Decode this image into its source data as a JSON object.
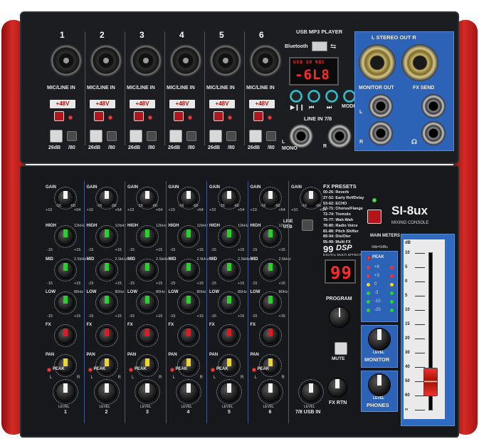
{
  "channels": [
    {
      "num": "1",
      "input": "MIC/LINE IN",
      "level": "LEVEL",
      "level_num": "1"
    },
    {
      "num": "2",
      "input": "MIC/LINE IN",
      "level": "LEVEL",
      "level_num": "2"
    },
    {
      "num": "3",
      "input": "MIC/LINE IN",
      "level": "LEVEL",
      "level_num": "3"
    },
    {
      "num": "4",
      "input": "MIC/LINE IN",
      "level": "LEVEL",
      "level_num": "4"
    },
    {
      "num": "5",
      "input": "MIC/LINE IN",
      "level": "LEVEL",
      "level_num": "5"
    },
    {
      "num": "6",
      "input": "MIC/LINE IN",
      "level": "LEVEL",
      "level_num": "6"
    }
  ],
  "phantom_label": "+48V",
  "pad_label": "26dB",
  "hpf_label": "/80",
  "strip": {
    "gain": "GAIN",
    "gain_min": "+10",
    "gain_mid1": "-16",
    "gain_mid2": "-60",
    "gain_max": "+54",
    "high": "HIGH",
    "high_freq": "12kHz",
    "mid": "MID",
    "mid_freq": "2.5kHz",
    "low": "LOW",
    "low_freq": "80Hz",
    "eq_min": "-15",
    "eq_max": "+15",
    "fx": "FX",
    "pan": "PAN",
    "pan_l": "L",
    "pan_r": "R",
    "peak": "PEAK"
  },
  "usb_player": {
    "title": "USB MP3 PLAYER",
    "bluetooth": "Bluetooth",
    "display": "-6L8",
    "ind": [
      "USB",
      "SD",
      "REC"
    ],
    "mode": "MODE"
  },
  "line_in_78": {
    "title": "LINE IN 7/8",
    "l": "L",
    "mono": "MONO",
    "r": "R"
  },
  "stereo_out": {
    "title": "L  STEREO OUT  R"
  },
  "monitor_out": {
    "title": "MONITOR OUT",
    "l": "L",
    "r": "R"
  },
  "fx_send": {
    "title": "FX SEND"
  },
  "line_usb": {
    "line": "LINE",
    "usb": "USB"
  },
  "ch78": {
    "level": "LEVEL",
    "name": "7/8  USB IN"
  },
  "fx_presets": {
    "title": "FX PRESETS",
    "items": [
      "00-26: Reverb",
      "27-52: Early Ref/Delay",
      "53-62: ECHO",
      "63-71: Chorus/Flange",
      "72-74: Tremolo",
      "75-77: Wah-Wah",
      "78-80: Radio Voice",
      "81-88: Pitch Shifter",
      "89-94: Dis/Oter",
      "95-99: Multi FX"
    ]
  },
  "dsp": {
    "big": "99",
    "dsp": "DSP",
    "sub": "DIGITAL MULTI EFFECTS",
    "display": "99",
    "program": "PROGRAM",
    "mute": "MUTE",
    "fx_rtn": "FX RTN"
  },
  "brand": {
    "model": "SI-8ux",
    "sub": "MIXING CONSOLE"
  },
  "meters": {
    "title": "MAIN METERS",
    "sub": "0db=0dBu",
    "peak": "PEAK",
    "scale": [
      "+6",
      "+3",
      "0",
      "-3",
      "-10",
      "-20"
    ]
  },
  "monitor": {
    "level": "LEVEL",
    "name": "MONITOR"
  },
  "phones": {
    "level": "LEVEL",
    "name": "PHONES"
  },
  "stereo_fader": {
    "db": "dB",
    "name": "STEREO",
    "scale": [
      "10",
      "5",
      "0",
      "5",
      "10",
      "15",
      "20",
      "30",
      "40",
      "50",
      "60",
      "∞"
    ]
  },
  "colors": {
    "chassis_red": "#d52a24",
    "panel": "#16181b",
    "accent_blue": "#2d63b6",
    "display_red": "#ff2a2a"
  }
}
